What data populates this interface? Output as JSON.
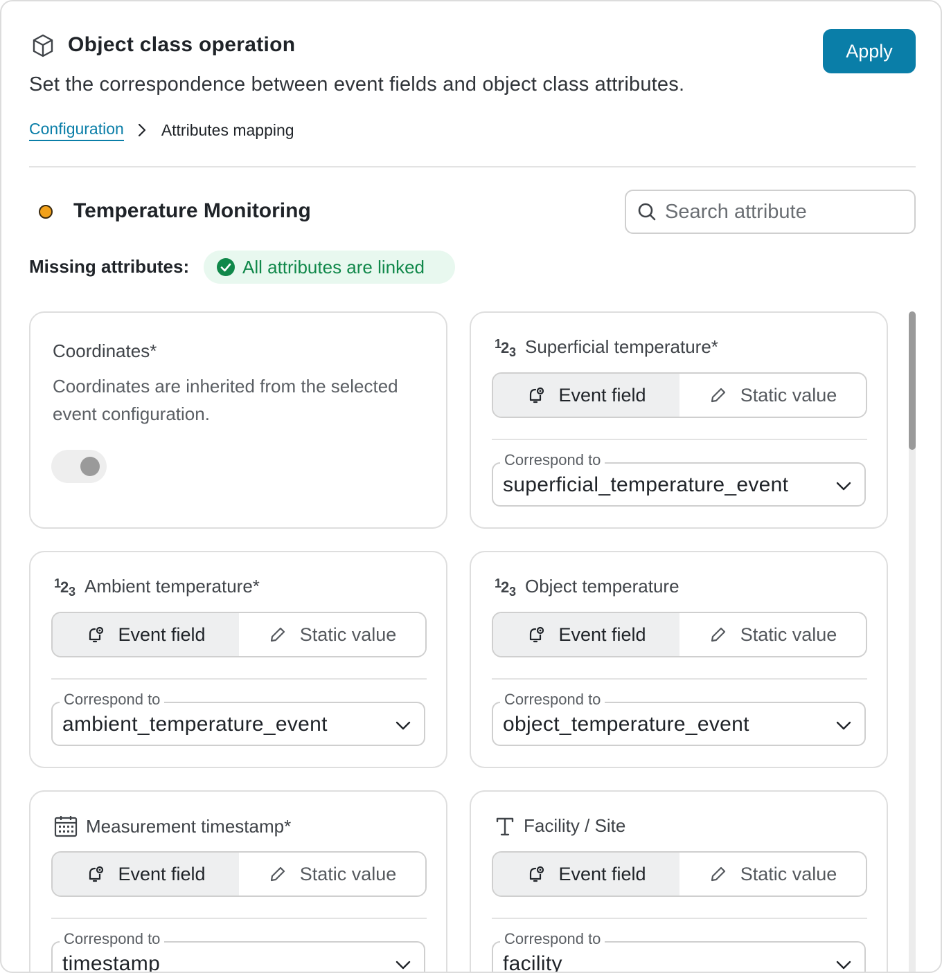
{
  "header": {
    "title": "Object class operation",
    "subtitle": "Set the correspondence between event fields and object class attributes.",
    "apply_label": "Apply",
    "icon": "cube-icon"
  },
  "breadcrumb": {
    "link": "Configuration",
    "current": "Attributes mapping"
  },
  "section": {
    "title": "Temperature Monitoring",
    "status_color": "#f2a11a",
    "search_placeholder": "Search attribute",
    "missing_label": "Missing attributes:",
    "linked_text": "All attributes are linked"
  },
  "cards": {
    "coordinates": {
      "title": "Coordinates*",
      "description": "Coordinates are inherited from the selected event configuration."
    },
    "superficial": {
      "title": "Superficial temperature*",
      "event_label": "Event field",
      "static_label": "Static value",
      "correspond_label": "Correspond to",
      "value": "superficial_temperature_event"
    },
    "ambient": {
      "title": "Ambient temperature*",
      "event_label": "Event field",
      "static_label": "Static value",
      "correspond_label": "Correspond to",
      "value": "ambient_temperature_event"
    },
    "object": {
      "title": "Object temperature",
      "event_label": "Event field",
      "static_label": "Static value",
      "correspond_label": "Correspond to",
      "value": "object_temperature_event"
    },
    "timestamp": {
      "title": "Measurement timestamp*",
      "event_label": "Event field",
      "static_label": "Static value",
      "correspond_label": "Correspond to",
      "value": "timestamp"
    },
    "facility": {
      "title": "Facility / Site",
      "event_label": "Event field",
      "static_label": "Static value",
      "correspond_label": "Correspond to",
      "value": "facility"
    }
  },
  "colors": {
    "accent": "#0a7ea8",
    "success": "#10884a",
    "success_bg": "#e8f8ef"
  }
}
